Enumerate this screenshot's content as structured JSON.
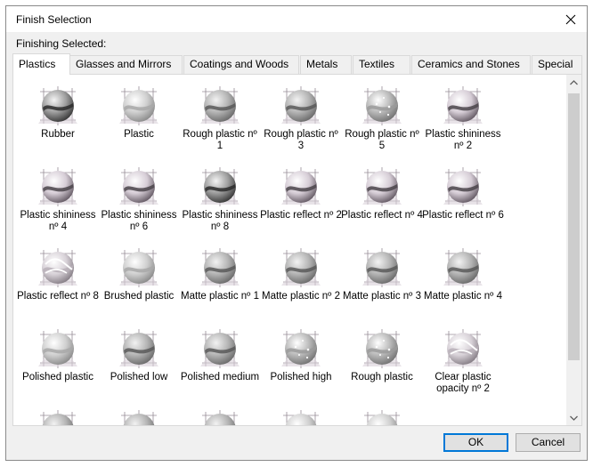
{
  "window": {
    "title": "Finish Selection"
  },
  "finishing_selected_label": "Finishing Selected:",
  "tabs": [
    {
      "label": "Plastics",
      "active": true
    },
    {
      "label": "Glasses and Mirrors"
    },
    {
      "label": "Coatings and Woods"
    },
    {
      "label": "Metals"
    },
    {
      "label": "Textiles"
    },
    {
      "label": "Ceramics and Stones"
    },
    {
      "label": "Special"
    }
  ],
  "materials": [
    {
      "label": "Rubber",
      "style": "dark"
    },
    {
      "label": "Plastic",
      "style": "light"
    },
    {
      "label": "Rough plastic nº 1",
      "style": "grey"
    },
    {
      "label": "Rough plastic nº 3",
      "style": "grey"
    },
    {
      "label": "Rough plastic nº 5",
      "style": "speckled"
    },
    {
      "label": "Plastic shininess nº 2",
      "style": "shiny"
    },
    {
      "label": "Plastic shininess nº 4",
      "style": "shiny"
    },
    {
      "label": "Plastic shininess nº 6",
      "style": "shiny"
    },
    {
      "label": "Plastic shininess nº 8",
      "style": "dark"
    },
    {
      "label": "Plastic reflect nº 2",
      "style": "shiny"
    },
    {
      "label": "Plastic reflect nº 4",
      "style": "shiny"
    },
    {
      "label": "Plastic reflect nº 6",
      "style": "shiny"
    },
    {
      "label": "Plastic reflect nº 8",
      "style": "patterned"
    },
    {
      "label": "Brushed plastic",
      "style": "light"
    },
    {
      "label": "Matte plastic nº 1",
      "style": "grey"
    },
    {
      "label": "Matte plastic nº 2",
      "style": "grey"
    },
    {
      "label": "Matte plastic nº 3",
      "style": "grey"
    },
    {
      "label": "Matte plastic nº 4",
      "style": "grey"
    },
    {
      "label": "Polished plastic",
      "style": "light"
    },
    {
      "label": "Polished low",
      "style": "grey"
    },
    {
      "label": "Polished medium",
      "style": "grey"
    },
    {
      "label": "Polished high",
      "style": "speckled"
    },
    {
      "label": "Rough plastic",
      "style": "speckled"
    },
    {
      "label": "Clear plastic opacity nº 2",
      "style": "patterned"
    },
    {
      "label": "",
      "style": "grey"
    },
    {
      "label": "",
      "style": "grey"
    },
    {
      "label": "",
      "style": "grey"
    },
    {
      "label": "",
      "style": "light"
    },
    {
      "label": "",
      "style": "light"
    }
  ],
  "buttons": {
    "ok": "OK",
    "cancel": "Cancel"
  },
  "icons": {
    "close": "close-icon",
    "scroll_up": "chevron-up-icon",
    "scroll_down": "chevron-down-icon"
  },
  "colors": {
    "accent": "#0078d7",
    "dialog_bg": "#f0f0f0",
    "panel_bg": "#ffffff"
  }
}
